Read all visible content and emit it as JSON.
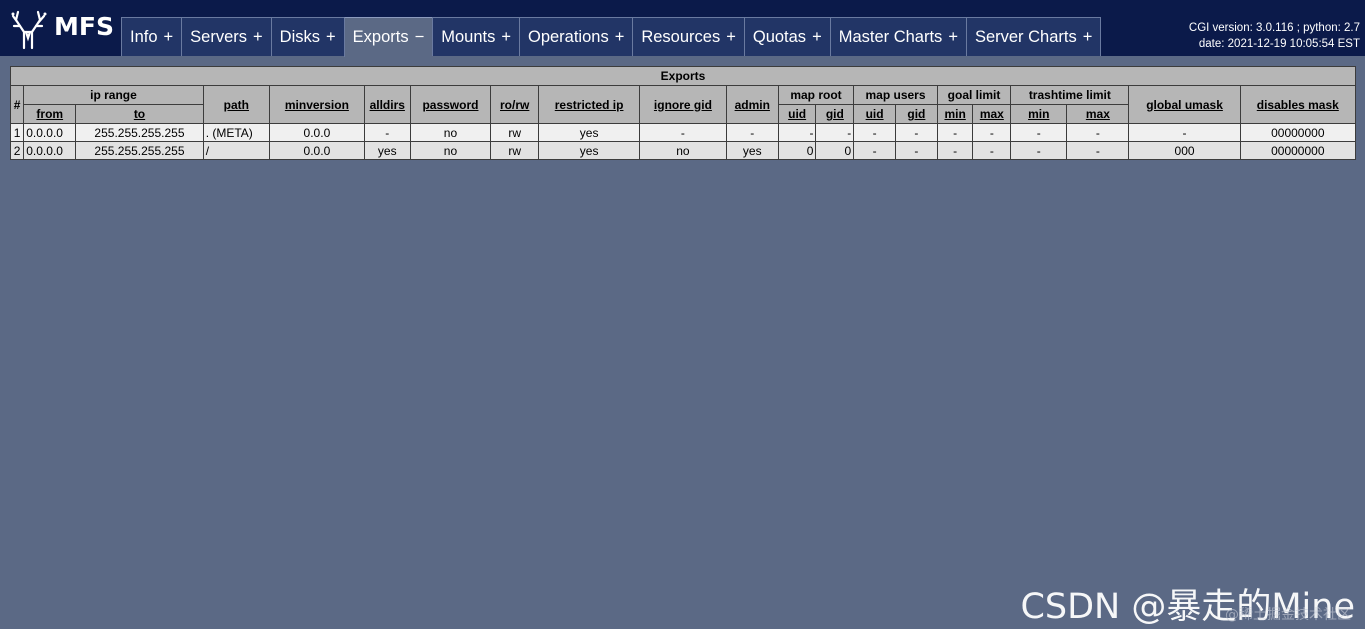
{
  "header": {
    "logo_text": "MFS",
    "cgi_version_line": "CGI version: 3.0.116 ; python: 2.7",
    "date_line": "date: 2021-12-19 10:05:54 EST"
  },
  "nav": {
    "tabs": [
      {
        "label": "Info",
        "sign": "+",
        "active": false
      },
      {
        "label": "Servers",
        "sign": "+",
        "active": false
      },
      {
        "label": "Disks",
        "sign": "+",
        "active": false
      },
      {
        "label": "Exports",
        "sign": "−",
        "active": true
      },
      {
        "label": "Mounts",
        "sign": "+",
        "active": false
      },
      {
        "label": "Operations",
        "sign": "+",
        "active": false
      },
      {
        "label": "Resources",
        "sign": "+",
        "active": false
      },
      {
        "label": "Quotas",
        "sign": "+",
        "active": false
      },
      {
        "label": "Master Charts",
        "sign": "+",
        "active": false
      },
      {
        "label": "Server Charts",
        "sign": "+",
        "active": false
      }
    ]
  },
  "table": {
    "title": "Exports",
    "headers": {
      "index": "#",
      "ip_range": "ip range",
      "from": "from",
      "to": "to",
      "path": "path",
      "minversion": "minversion",
      "alldirs": "alldirs",
      "password": "password",
      "rorw": "ro/rw",
      "restricted_ip": "restricted ip",
      "ignore_gid": "ignore gid",
      "admin": "admin",
      "map_root": "map root",
      "map_users": "map users",
      "uid": "uid",
      "gid": "gid",
      "goal_limit": "goal limit",
      "trashtime_limit": "trashtime limit",
      "min": "min",
      "max": "max",
      "global_umask": "global umask",
      "disables_mask": "disables mask"
    },
    "rows": [
      {
        "idx": "1",
        "from": "0.0.0.0",
        "to": "255.255.255.255",
        "path": ". (META)",
        "minversion": "0.0.0",
        "alldirs": "-",
        "password": "no",
        "rorw": "rw",
        "restricted_ip": "yes",
        "ignore_gid": "-",
        "admin": "-",
        "root_uid": "-",
        "root_gid": "-",
        "users_uid": "-",
        "users_gid": "-",
        "goal_min": "-",
        "goal_max": "-",
        "trash_min": "-",
        "trash_max": "-",
        "global_umask": "-",
        "disables_mask": "00000000"
      },
      {
        "idx": "2",
        "from": "0.0.0.0",
        "to": "255.255.255.255",
        "path": "/",
        "minversion": "0.0.0",
        "alldirs": "yes",
        "password": "no",
        "rorw": "rw",
        "restricted_ip": "yes",
        "ignore_gid": "no",
        "admin": "yes",
        "root_uid": "0",
        "root_gid": "0",
        "users_uid": "-",
        "users_gid": "-",
        "goal_min": "-",
        "goal_max": "-",
        "trash_min": "-",
        "trash_max": "-",
        "global_umask": "000",
        "disables_mask": "00000000"
      }
    ]
  },
  "watermark": {
    "text": "CSDN @暴走的Mine",
    "sub": "@稀土掘金技术社区"
  }
}
